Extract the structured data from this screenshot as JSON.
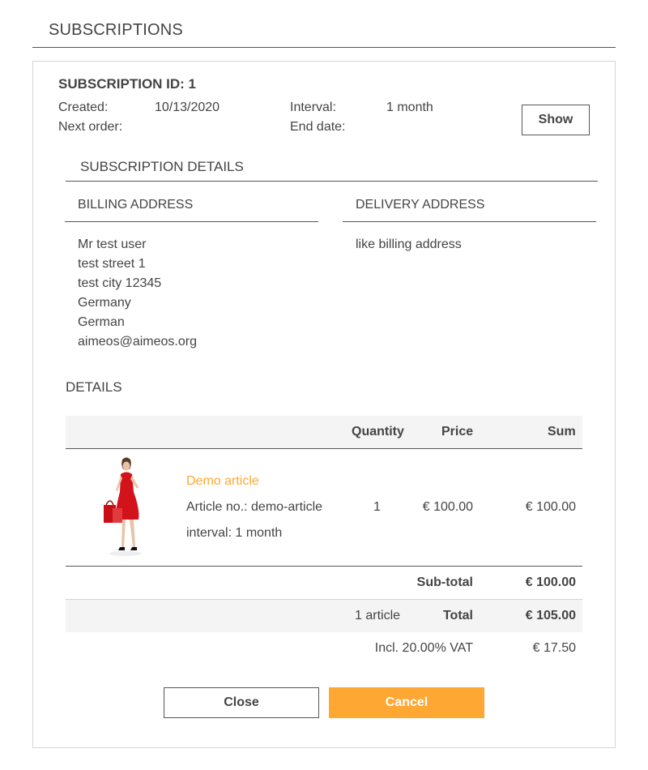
{
  "page": {
    "title": "SUBSCRIPTIONS"
  },
  "subscription": {
    "id_label": "SUBSCRIPTION ID: 1",
    "created_label": "Created:",
    "created_value": "10/13/2020",
    "next_order_label": "Next order:",
    "next_order_value": "",
    "interval_label": "Interval:",
    "interval_value": "1 month",
    "end_date_label": "End date:",
    "end_date_value": "",
    "show_button": "Show"
  },
  "details_section": {
    "title": "SUBSCRIPTION DETAILS",
    "billing": {
      "title": "BILLING ADDRESS",
      "lines": [
        "Mr test user",
        "test street 1",
        "test city 12345",
        "Germany",
        "German",
        "aimeos@aimeos.org"
      ]
    },
    "delivery": {
      "title": "DELIVERY ADDRESS",
      "text": "like billing address"
    }
  },
  "order": {
    "title": "DETAILS",
    "columns": {
      "quantity": "Quantity",
      "price": "Price",
      "sum": "Sum"
    },
    "item": {
      "name": "Demo article",
      "article_no": "Article no.: demo-article",
      "interval": "interval: 1 month",
      "quantity": "1",
      "price": "€ 100.00",
      "sum": "€ 100.00",
      "image_icon": "product-photo-woman-red-dress"
    },
    "subtotal_label": "Sub-total",
    "subtotal_value": "€ 100.00",
    "article_count": "1 article",
    "total_label": "Total",
    "total_value": "€ 105.00",
    "vat_label": "Incl. 20.00% VAT",
    "vat_value": "€ 17.50"
  },
  "actions": {
    "close": "Close",
    "cancel": "Cancel"
  },
  "colors": {
    "accent": "#ffa733",
    "border": "#555555",
    "row_bg": "#f4f4f4"
  }
}
